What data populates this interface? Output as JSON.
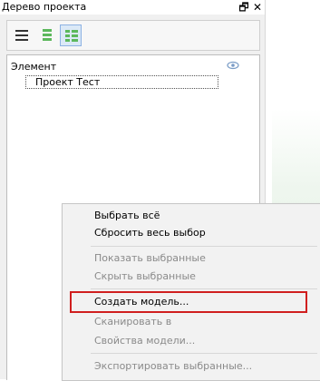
{
  "panel": {
    "title": "Дерево проекта"
  },
  "tree": {
    "column_header": "Элемент",
    "items": [
      {
        "label": "Проект Тест"
      }
    ]
  },
  "context_menu": {
    "items": [
      {
        "label": "Выбрать всё",
        "enabled": true
      },
      {
        "label": "Сбросить весь выбор",
        "enabled": true
      },
      {
        "label": "Показать выбранные",
        "enabled": false
      },
      {
        "label": "Скрыть выбранные",
        "enabled": false
      },
      {
        "label": "Создать модель...",
        "enabled": true,
        "highlighted": true
      },
      {
        "label": "Сканировать в",
        "enabled": false
      },
      {
        "label": "Свойства модели...",
        "enabled": false
      },
      {
        "label": "Экспортировать выбранные...",
        "enabled": false
      }
    ]
  },
  "colors": {
    "highlight_border": "#d01f1f",
    "tool_green": "#5cb85c",
    "active_tool_bg": "#dbe9f7"
  }
}
